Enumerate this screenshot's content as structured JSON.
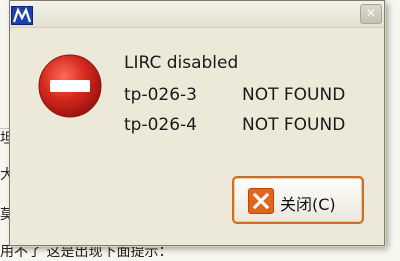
{
  "dialog": {
    "close_glyph": "×",
    "message_title": "LIRC disabled",
    "devices": [
      {
        "name": "tp-026-3",
        "status": "NOT FOUND"
      },
      {
        "name": "tp-026-4",
        "status": "NOT FOUND"
      }
    ],
    "close_button_label": "关闭(C)"
  },
  "background": {
    "fragments": [
      "坦",
      "大",
      "莫",
      "用不了    这是出现下面提示："
    ]
  },
  "icons": {
    "app": "app-logo-icon",
    "error": "error-stop-icon",
    "button": "x-close-icon"
  },
  "colors": {
    "error_red": "#d42a1e",
    "button_accent": "#e3641c"
  }
}
